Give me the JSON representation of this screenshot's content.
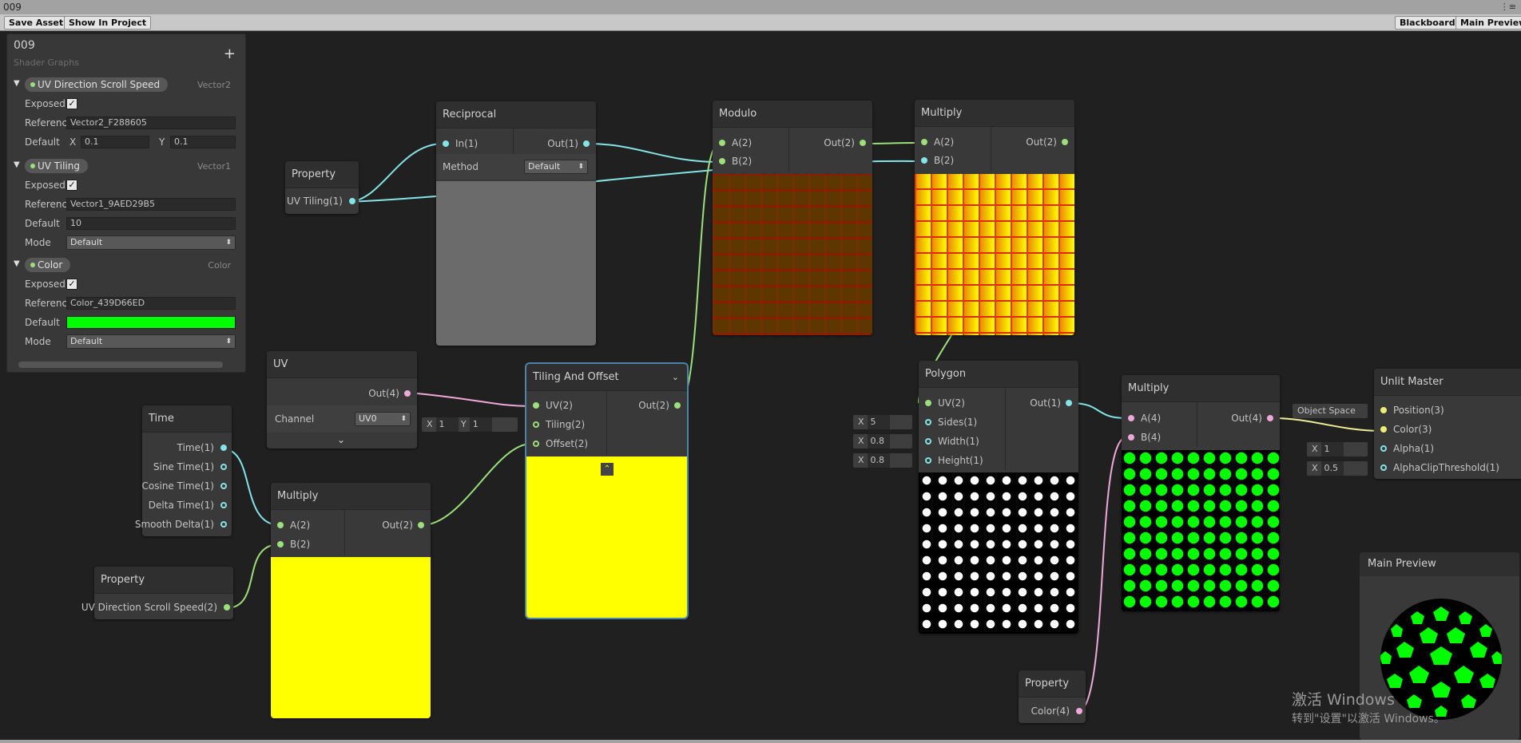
{
  "window": {
    "title": "009"
  },
  "toolbar": {
    "save_asset": "Save Asset",
    "show_in_project": "Show In Project",
    "blackboard": "Blackboard",
    "main_preview": "Main Preview"
  },
  "blackboard": {
    "title": "009",
    "subtitle": "Shader Graphs",
    "plus": "+",
    "properties": [
      {
        "name": "UV Direction Scroll Speed",
        "type": "Vector2",
        "exposed_label": "Exposed",
        "reference_label": "Reference",
        "reference": "Vector2_F288605",
        "default_label": "Default",
        "x_label": "X",
        "x": "0.1",
        "y_label": "Y",
        "y": "0.1"
      },
      {
        "name": "UV Tiling",
        "type": "Vector1",
        "exposed_label": "Exposed",
        "reference_label": "Reference",
        "reference": "Vector1_9AED29B5",
        "default_label": "Default",
        "default": "10",
        "mode_label": "Mode",
        "mode": "Default"
      },
      {
        "name": "Color",
        "type": "Color",
        "exposed_label": "Exposed",
        "reference_label": "Reference",
        "reference": "Color_439D66ED",
        "default_label": "Default",
        "default_color": "#00ff00",
        "mode_label": "Mode",
        "mode": "Default"
      }
    ]
  },
  "nodes": {
    "property_uvtiling": {
      "title": "Property",
      "out": "UV Tiling(1)"
    },
    "reciprocal": {
      "title": "Reciprocal",
      "in": "In(1)",
      "out": "Out(1)",
      "method_label": "Method",
      "method": "Default"
    },
    "modulo": {
      "title": "Modulo",
      "a": "A(2)",
      "b": "B(2)",
      "out": "Out(2)"
    },
    "multiply_top": {
      "title": "Multiply",
      "a": "A(2)",
      "b": "B(2)",
      "out": "Out(2)"
    },
    "uv": {
      "title": "UV",
      "out": "Out(4)",
      "channel_label": "Channel",
      "channel": "UV0"
    },
    "tiling_offset": {
      "title": "Tiling And Offset",
      "uv": "UV(2)",
      "tiling": "Tiling(2)",
      "offset": "Offset(2)",
      "out": "Out(2)",
      "tiling_x_label": "X",
      "tiling_x": "1",
      "tiling_y_label": "Y",
      "tiling_y": "1"
    },
    "time": {
      "title": "Time",
      "outs": [
        "Time(1)",
        "Sine Time(1)",
        "Cosine Time(1)",
        "Delta Time(1)",
        "Smooth Delta(1)"
      ]
    },
    "multiply_mid": {
      "title": "Multiply",
      "a": "A(2)",
      "b": "B(2)",
      "out": "Out(2)"
    },
    "property_scroll": {
      "title": "Property",
      "out": "UV Direction Scroll Speed(2)"
    },
    "polygon": {
      "title": "Polygon",
      "uv": "UV(2)",
      "sides": "Sides(1)",
      "width": "Width(1)",
      "height": "Height(1)",
      "out": "Out(1)",
      "sides_x_label": "X",
      "sides_val": "5",
      "width_x_label": "X",
      "width_val": "0.8",
      "height_x_label": "X",
      "height_val": "0.8"
    },
    "multiply_right": {
      "title": "Multiply",
      "a": "A(4)",
      "b": "B(4)",
      "out": "Out(4)"
    },
    "unlit_master": {
      "title": "Unlit Master",
      "position": "Position(3)",
      "color": "Color(3)",
      "alpha": "Alpha(1)",
      "clip": "AlphaClipThreshold(1)",
      "space": "Object Space",
      "alpha_x_label": "X",
      "alpha_val": "1",
      "clip_x_label": "X",
      "clip_val": "0.5"
    },
    "property_color": {
      "title": "Property",
      "out": "Color(4)"
    }
  },
  "main_preview": {
    "title": "Main Preview"
  },
  "watermark": {
    "line1": "激活 Windows",
    "line2": "转到\"设置\"以激活 Windows。"
  },
  "colors": {
    "accent_cyan": "#84e4e7",
    "accent_green": "#9be07a",
    "accent_pink": "#f0a8d8",
    "yellow": "#ffff00",
    "green": "#00ff00"
  }
}
